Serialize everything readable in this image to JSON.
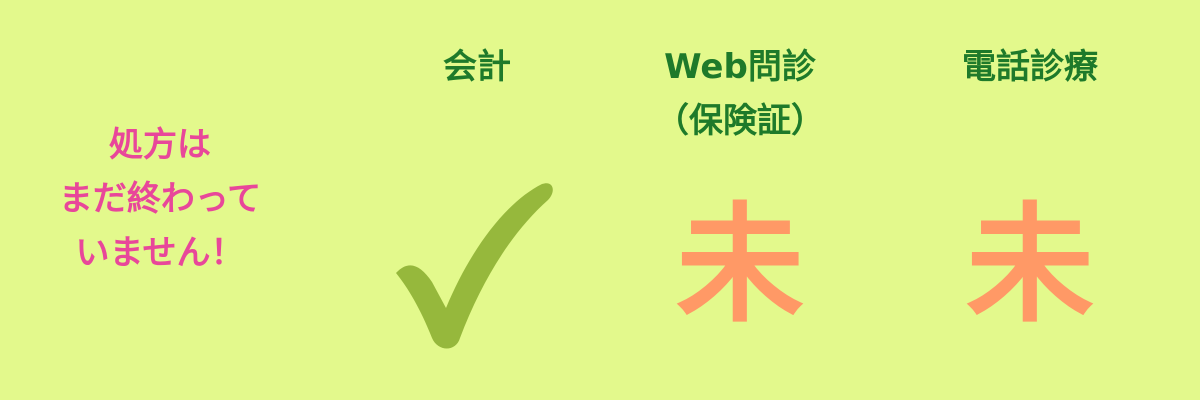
{
  "colors": {
    "background": "#E3F98C",
    "message": "#E8479A",
    "header": "#1E7A2A",
    "check": "#96B83C",
    "pending": "#FF9966"
  },
  "message": {
    "lines": [
      "処方は",
      "まだ終わって",
      "いません！"
    ]
  },
  "columns": [
    {
      "header_lines": [
        "会計"
      ],
      "status": "done",
      "status_icon": "checkmark-icon"
    },
    {
      "header_lines": [
        "Web問診",
        "（保険証）"
      ],
      "status": "pending",
      "status_text": "未"
    },
    {
      "header_lines": [
        "電話診療"
      ],
      "status": "pending",
      "status_text": "未"
    }
  ]
}
